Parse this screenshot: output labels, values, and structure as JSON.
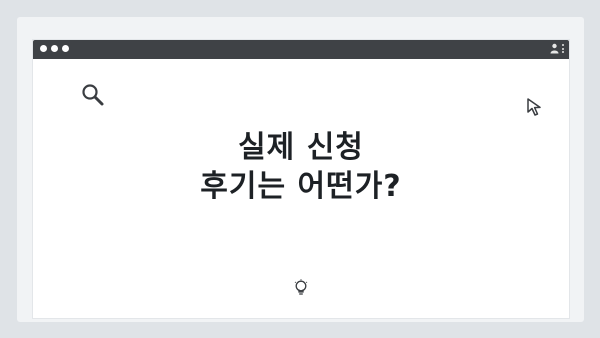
{
  "headline": {
    "line1": "실제 신청",
    "line2": "후기는 어떤가?"
  },
  "icons": {
    "top_pager": "pager-dots",
    "window_controls": "window-dots",
    "user": "user-icon",
    "menu": "kebab-menu-icon",
    "search": "search-icon",
    "cursor": "cursor-icon",
    "idea": "lightbulb-icon"
  },
  "colors": {
    "page_background": "#dfe3e7",
    "card_background": "#f1f3f5",
    "titlebar": "#3f4246",
    "headline_text": "#1d2125"
  }
}
